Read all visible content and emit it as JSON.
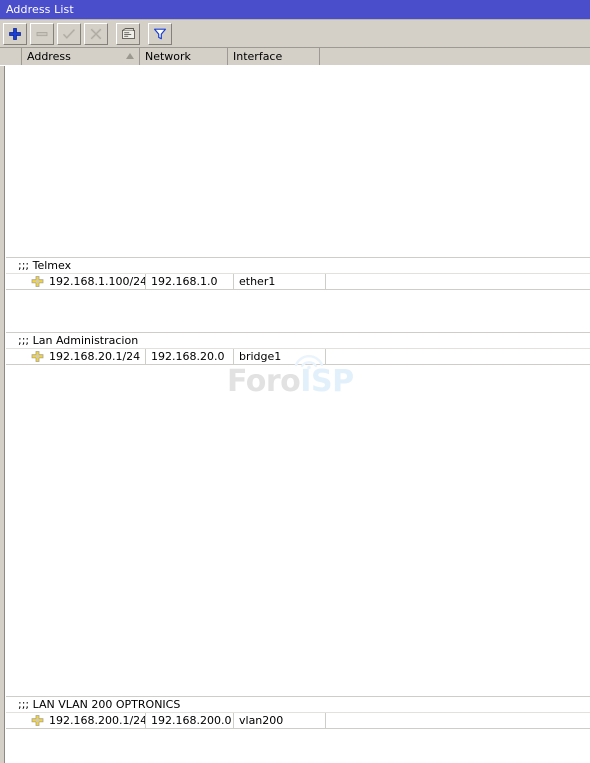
{
  "window": {
    "title": "Address List",
    "title_bar_color": "#4b4ecb",
    "chrome_color": "#d4d0c8"
  },
  "toolbar": {
    "buttons": [
      {
        "name": "add-button",
        "icon": "plus-icon",
        "label": "Add",
        "enabled": true
      },
      {
        "name": "remove-button",
        "icon": "minus-icon",
        "label": "Remove",
        "enabled": false
      },
      {
        "name": "enable-button",
        "icon": "check-icon",
        "label": "Enable",
        "enabled": false
      },
      {
        "name": "disable-button",
        "icon": "cross-icon",
        "label": "Disable",
        "enabled": false
      },
      {
        "name": "comment-button",
        "icon": "comment-icon",
        "label": "Comment",
        "enabled": true
      },
      {
        "name": "filter-button",
        "icon": "funnel-icon",
        "label": "Filter",
        "enabled": true
      }
    ]
  },
  "table": {
    "columns": [
      {
        "key": "flag",
        "label": "",
        "sorted": false
      },
      {
        "key": "address",
        "label": "Address",
        "sorted": true,
        "sort_direction": "asc"
      },
      {
        "key": "network",
        "label": "Network",
        "sorted": false
      },
      {
        "key": "interface",
        "label": "Interface",
        "sorted": false
      },
      {
        "key": "blank",
        "label": "",
        "sorted": false
      }
    ],
    "groups": [
      {
        "comment": ";;; Telmex",
        "rows": [
          {
            "icon": "address-entry-icon",
            "address": "192.168.1.100/24",
            "network": "192.168.1.0",
            "interface": "ether1"
          }
        ]
      },
      {
        "comment": ";;; Lan Administracion",
        "rows": [
          {
            "icon": "address-entry-icon",
            "address": "192.168.20.1/24",
            "network": "192.168.20.0",
            "interface": "bridge1"
          }
        ]
      },
      {
        "comment": ";;; LAN VLAN 200 OPTRONICS",
        "rows": [
          {
            "icon": "address-entry-icon",
            "address": "192.168.200.1/24",
            "network": "192.168.200.0",
            "interface": "vlan200"
          }
        ]
      }
    ]
  },
  "watermark": {
    "text_primary": "Foro",
    "text_secondary": "ISP",
    "color_primary": "#e2e2e2",
    "color_secondary": "#e2f0fb"
  }
}
